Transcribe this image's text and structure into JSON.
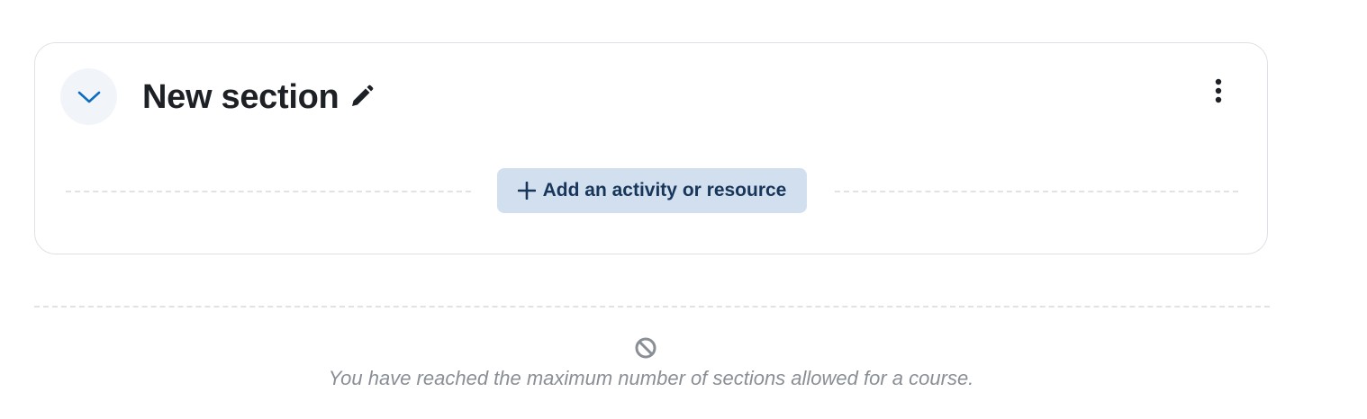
{
  "section": {
    "title": "New section",
    "add_button_label": "Add an activity or resource"
  },
  "notice": {
    "message": "You have reached the maximum number of sections allowed for a course."
  },
  "icons": {
    "collapse": "chevron-down-icon",
    "edit": "pencil-icon",
    "menu": "kebab-menu-icon",
    "add": "plus-icon",
    "limit": "ban-icon"
  },
  "colors": {
    "accent": "#0f6cbf",
    "add_button_bg": "#d1dfee",
    "add_button_text": "#17365a",
    "muted_text": "#8a8f95"
  }
}
